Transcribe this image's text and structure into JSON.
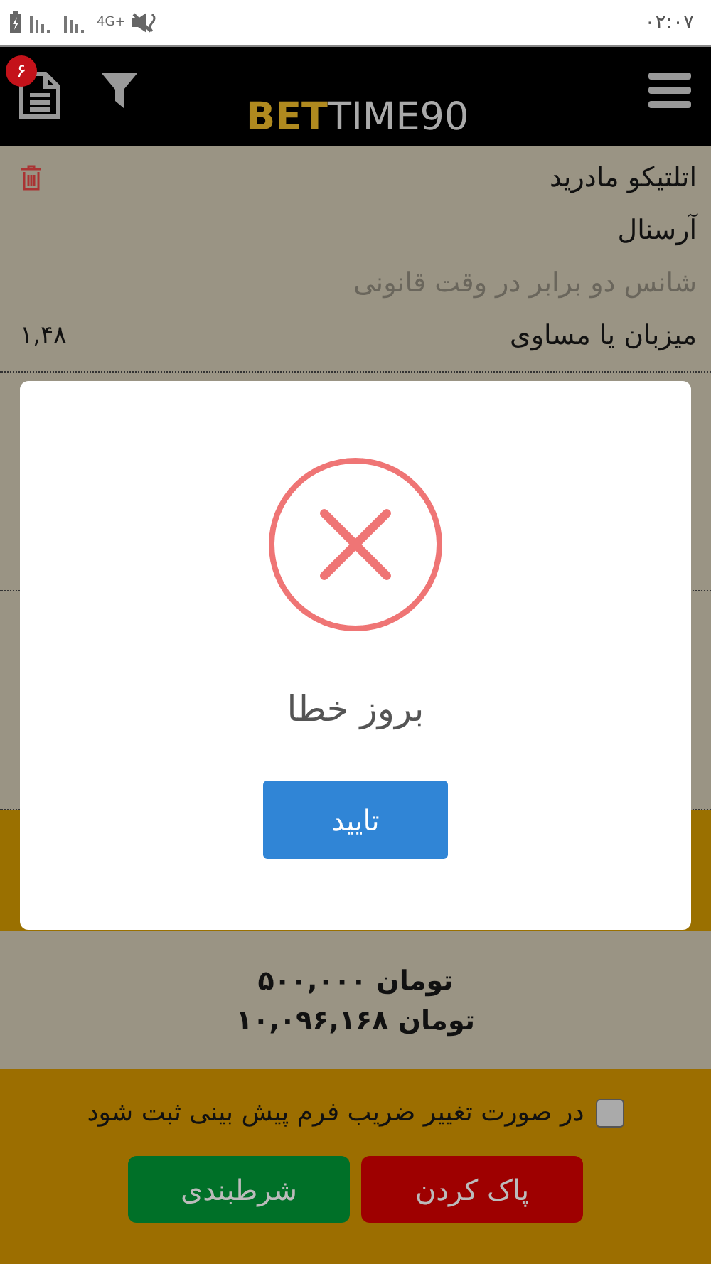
{
  "status_bar": {
    "network": "4G+",
    "time": "۰۲:۰۷"
  },
  "header": {
    "logo_bold": "BET",
    "logo_light": "TIME90",
    "slip_count": "۶"
  },
  "bets": [
    {
      "home": "اتلتیکو مادرید",
      "away": "آرسنال",
      "market": "شانس دو برابر در وقت قانونی",
      "pick": "میزبان یا مساوی",
      "odds": "۱,۴۸"
    }
  ],
  "summary": {
    "stake": "تومان ۵۰۰,۰۰۰",
    "payout": "تومان ۱۰,۰۹۶,۱۶۸"
  },
  "odds_change": {
    "label": "در صورت تغییر ضریب فرم پیش بینی ثبت شود",
    "checked": false
  },
  "buttons": [
    {
      "label": "پاک کردن",
      "kind": "danger"
    },
    {
      "label": "شرطبندی",
      "kind": "success"
    }
  ],
  "dialog": {
    "message": "بروز خطا",
    "button": "تایید"
  }
}
